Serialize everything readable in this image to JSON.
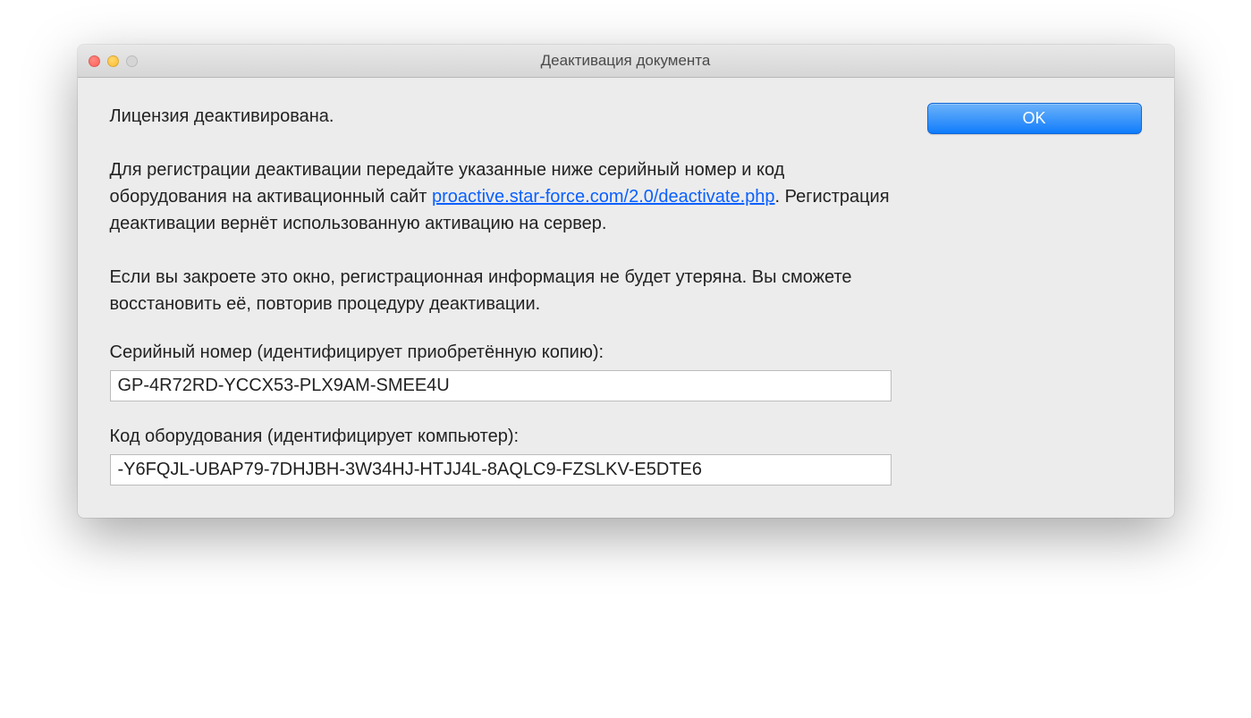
{
  "window": {
    "title": "Деактивация документа"
  },
  "body": {
    "line1": "Лицензия деактивирована.",
    "para2_pre": "Для регистрации деактивации передайте указанные ниже серийный номер и код оборудования на активационный сайт ",
    "para2_link": "proactive.star-force.com/2.0/deactivate.php",
    "para2_post": ". Регистрация деактивации вернёт использованную активацию на сервер.",
    "para3": "Если вы закроете это окно, регистрационная информация не будет утеряна. Вы сможете восстановить её, повторив процедуру деактивации."
  },
  "fields": {
    "serial_label": "Серийный номер (идентифицирует приобретённую копию):",
    "serial_value": "GP-4R72RD-YCCX53-PLX9AM-SMEE4U",
    "hardware_label": "Код оборудования (идентифицирует компьютер):",
    "hardware_value": "-Y6FQJL-UBAP79-7DHJBH-3W34HJ-HTJJ4L-8AQLC9-FZSLKV-E5DTE6"
  },
  "buttons": {
    "ok": "OK"
  }
}
